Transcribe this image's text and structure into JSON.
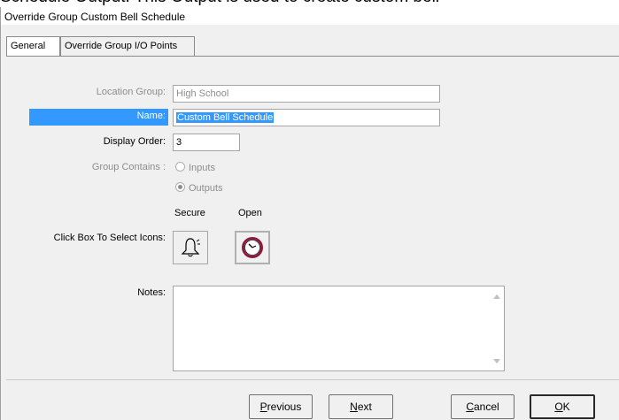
{
  "page_caption": "Schedule Output. This Output is used to create custom bell",
  "window": {
    "title": "Override Group Custom Bell Schedule"
  },
  "tabs": [
    {
      "label": "General",
      "active": true
    },
    {
      "label": "Override Group I/O Points",
      "active": false
    }
  ],
  "form": {
    "location_group": {
      "label": "Location Group:",
      "value": "High School"
    },
    "name": {
      "label": "Name:",
      "value": "Custom Bell Schedule"
    },
    "display_order": {
      "label": "Display Order:",
      "value": "3"
    },
    "group_contains": {
      "label": "Group Contains :",
      "options": [
        {
          "label": "Inputs",
          "selected": false
        },
        {
          "label": "Outputs",
          "selected": true
        }
      ]
    },
    "icons": {
      "label": "Click Box To Select Icons:",
      "secure_label": "Secure",
      "open_label": "Open",
      "secure_icon": "bell-icon",
      "open_icon": "clock-icon"
    },
    "notes": {
      "label": "Notes:",
      "value": ""
    }
  },
  "buttons": {
    "previous": {
      "mnemonic": "P",
      "rest": "revious"
    },
    "next": {
      "mnemonic": "N",
      "rest": "ext"
    },
    "cancel": {
      "mnemonic": "C",
      "rest": "ancel"
    },
    "ok": {
      "mnemonic": "O",
      "rest": "K"
    }
  },
  "colors": {
    "selection": "#3399ff",
    "clock_rim": "#8b1a3c",
    "disabled_text": "#8d8d8d"
  }
}
